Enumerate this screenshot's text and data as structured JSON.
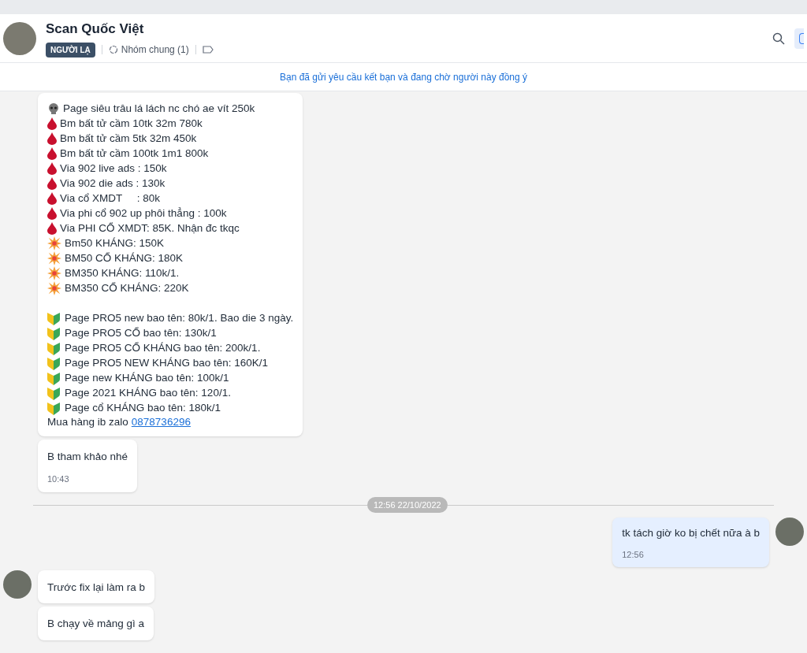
{
  "header": {
    "name": "Scan Quốc Việt",
    "badge": "NGƯỜI LẠ",
    "group": "Nhóm chung (1)"
  },
  "banner": "Bạn đã gửi yêu cầu kết bạn và đang chờ người này đồng ý",
  "messages": [
    {
      "kind": "in",
      "avatar": false,
      "lines": [
        {
          "kind": "skull",
          "text": "Page siêu trâu lá lách nc chó ae vít 250k"
        },
        {
          "kind": "drop",
          "text": "Bm bất tử cầm 10tk 32m 780k"
        },
        {
          "kind": "drop",
          "text": "Bm bất tử cầm 5tk 32m 450k"
        },
        {
          "kind": "drop",
          "text": "Bm bất tử cầm 100tk 1m1 800k"
        },
        {
          "kind": "drop",
          "text": "Via 902 live ads : 150k"
        },
        {
          "kind": "drop",
          "text": "Via 902 die ads : 130k"
        },
        {
          "kind": "drop",
          "text": "Via cổ XMDT     : 80k"
        },
        {
          "kind": "drop",
          "text": "Via phi cổ 902 up phôi thẳng : 100k"
        },
        {
          "kind": "drop",
          "text": "Via PHI CỔ XMDT: 85K. Nhận đc tkqc"
        },
        {
          "kind": "burst",
          "text": "Bm50 KHÁNG: 150K"
        },
        {
          "kind": "burst",
          "text": "BM50 CỔ KHÁNG: 180K"
        },
        {
          "kind": "burst",
          "text": "BM350 KHÁNG: 110k/1."
        },
        {
          "kind": "burst",
          "text": "BM350 CỔ KHÁNG: 220K"
        },
        {
          "kind": "blank"
        },
        {
          "kind": "shield",
          "text": "Page PRO5 new bao tên: 80k/1. Bao die 3 ngày."
        },
        {
          "kind": "shield",
          "text": "Page PRO5 CỔ bao tên: 130k/1"
        },
        {
          "kind": "shield",
          "text": "Page PRO5 CỔ KHÁNG bao tên: 200k/1."
        },
        {
          "kind": "shield",
          "text": "Page PRO5 NEW KHÁNG bao tên: 160K/1"
        },
        {
          "kind": "shield",
          "text": "Page new KHÁNG bao tên: 100k/1"
        },
        {
          "kind": "shield",
          "text": "Page 2021 KHÁNG bao tên: 120/1."
        },
        {
          "kind": "shield",
          "text": "Page cổ KHÁNG bao tên: 180k/1"
        }
      ],
      "footer": {
        "text": "Mua hàng ib zalo",
        "link": "0878736296"
      }
    },
    {
      "kind": "in",
      "avatar": false,
      "text": "B tham khảo nhé",
      "time": "10:43"
    },
    {
      "kind": "divider",
      "text": "12:56 22/10/2022"
    },
    {
      "kind": "out",
      "avatar": true,
      "text": "tk tách giờ ko bị chết nữa à b",
      "time": "12:56"
    },
    {
      "kind": "in",
      "avatar": true,
      "text": "Trước fix lại làm ra b"
    },
    {
      "kind": "in",
      "avatar": false,
      "text": "B chạy về mảng gì a"
    }
  ]
}
